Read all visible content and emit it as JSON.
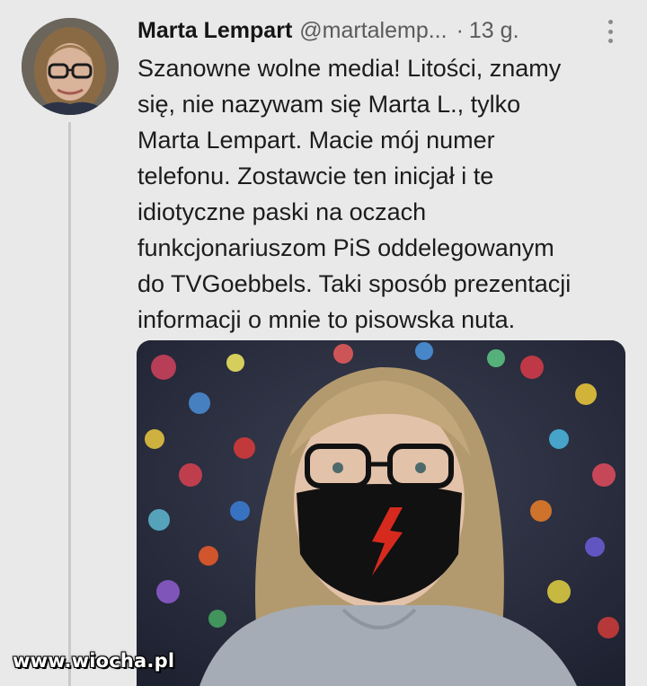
{
  "tweet": {
    "display_name": "Marta Lempart",
    "handle": "@martalemp...",
    "separator": "·",
    "time": "13 g.",
    "text_lines": [
      "Szanowne wolne media! Litości, znamy",
      "się, nie nazywam się Marta L., tylko",
      "Marta Lempart. Macie mój numer",
      "telefonu. Zostawcie ten inicjał i te",
      "idiotyczne paski na oczach",
      "funkcjonariuszom PiS oddelegowanym",
      "do TVGoebbels. Taki sposób prezentacji",
      "informacji o mnie to pisowska nuta."
    ]
  },
  "icons": {
    "more": "more-vertical-icon",
    "avatar": "avatar-photo",
    "mask_symbol": "red-lightning-bolt"
  },
  "watermark": "www.wiocha.pl",
  "colors": {
    "background": "#e9e9e9",
    "text": "#1c1c1c",
    "secondary": "#5b5b5b",
    "thread_line": "#c9c9c9",
    "mask": "#111111",
    "bolt": "#d62a1e"
  }
}
